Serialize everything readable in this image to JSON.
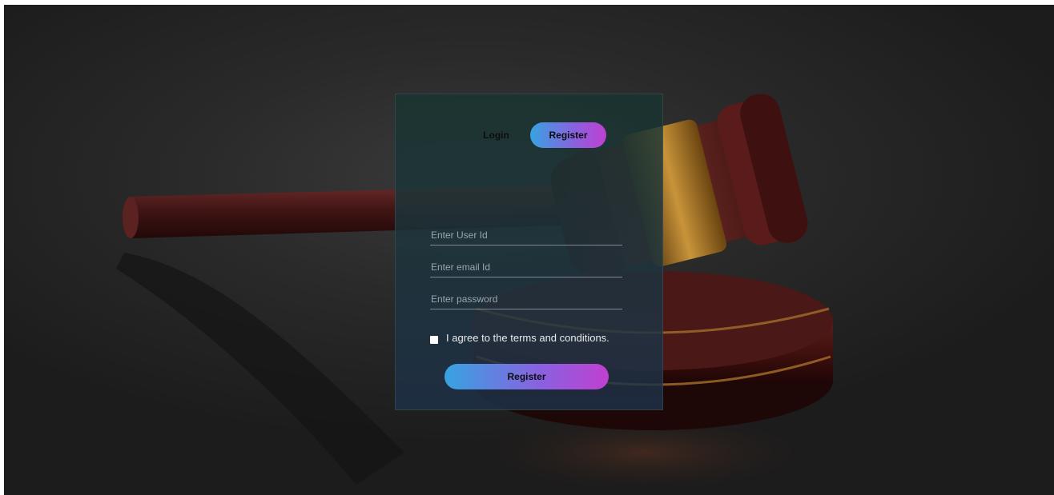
{
  "tabs": {
    "login_label": "Login",
    "register_label": "Register"
  },
  "form": {
    "user_id_placeholder": "Enter User Id",
    "email_placeholder": "Enter email Id",
    "password_placeholder": "Enter password",
    "agree_label": "I agree to the terms and conditions.",
    "submit_label": "Register"
  },
  "colors": {
    "accent_start": "#37a3e0",
    "accent_end": "#c040d0",
    "card_tint": "#1c3440"
  },
  "icons": {
    "background": "gavel-image"
  }
}
